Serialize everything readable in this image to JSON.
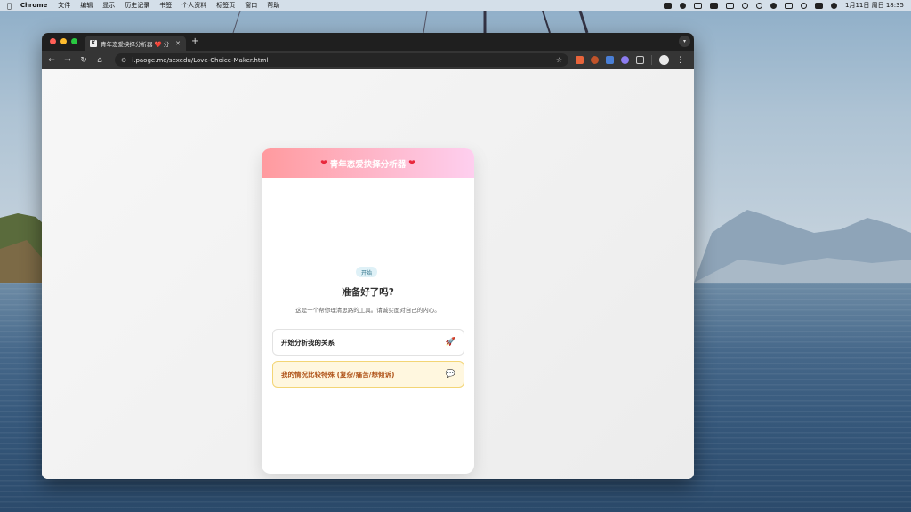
{
  "menubar": {
    "app_name": "Chrome",
    "items": [
      "文件",
      "编辑",
      "显示",
      "历史记录",
      "书签",
      "个人资料",
      "标签页",
      "窗口",
      "帮助"
    ],
    "clock": "1月11日 周日  18:35"
  },
  "browser": {
    "tab_title": "青年恋爱抉择分析器 ❤️ 分",
    "favicon_text": "K",
    "url": "i.paoge.me/sexedu/Love-Choice-Maker.html"
  },
  "app": {
    "header_title": "青年恋爱抉择分析器",
    "step_badge": "开始",
    "question": "准备好了吗?",
    "subtitle": "这是一个帮你理清思路的工具。请诚实面对自己的内心。",
    "options": [
      {
        "label": "开始分析我的关系",
        "icon": "rocket-icon"
      },
      {
        "label": "我的情况比较特殊 (复杂/痛苦/想倾诉)",
        "icon": "speech-bubble-icon"
      }
    ]
  },
  "colors": {
    "header_gradient_start": "#ff9a9e",
    "header_gradient_end": "#fecfef",
    "option_special_bg": "#fff7df",
    "option_special_border": "#f3d575",
    "option_special_text": "#b0541a",
    "badge_bg": "#dff1f7"
  }
}
